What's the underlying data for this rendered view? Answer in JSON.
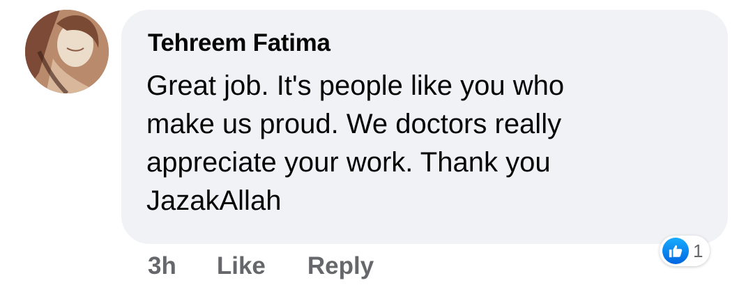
{
  "comment": {
    "author": "Tehreem Fatima",
    "text": "Great job. It's people like you who\nmake us proud. We doctors really\nappreciate your work. Thank you\nJazakAllah",
    "timestamp": "3h",
    "like_label": "Like",
    "reply_label": "Reply",
    "reaction_icon": "thumbs-up-icon",
    "reaction_count": "1"
  },
  "colors": {
    "bubble_bg": "#f0f2f5",
    "text": "#050505",
    "secondary_text": "#65676b",
    "like_blue": "#0866ff"
  }
}
